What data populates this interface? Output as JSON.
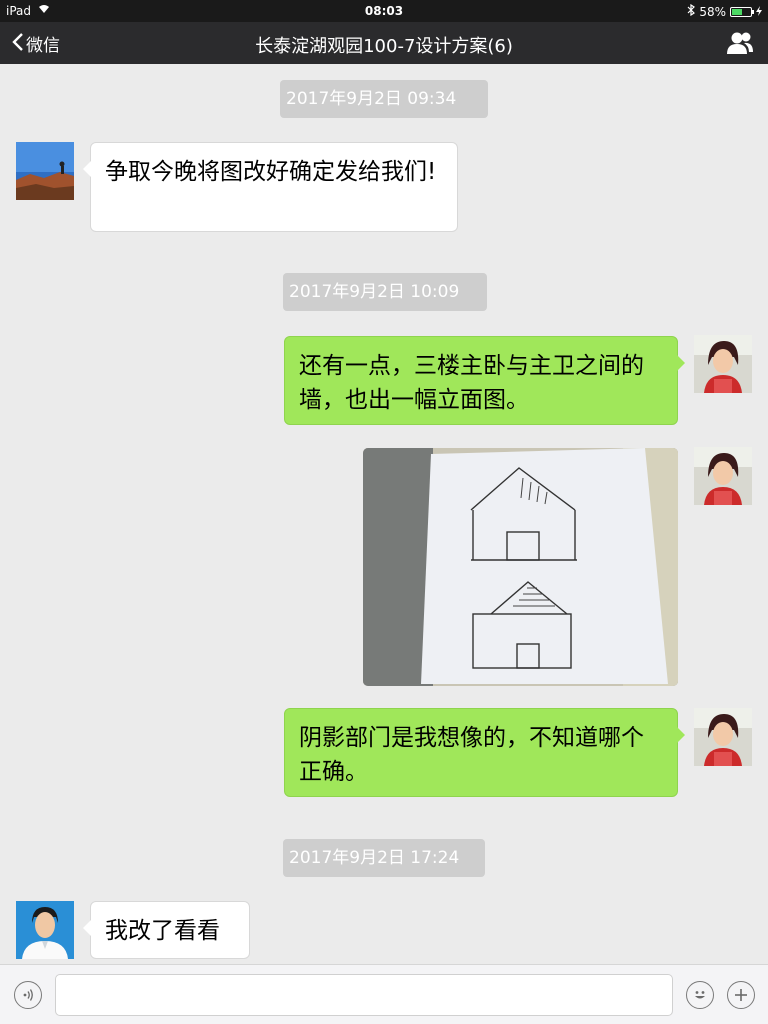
{
  "status_bar": {
    "device": "iPad",
    "time": "08:03",
    "battery": "58%",
    "battery_level": 0.58
  },
  "nav": {
    "back_label": "微信",
    "title": "长泰淀湖观园100-7设计方案(6)",
    "contacts_icon": "group-contacts-icon"
  },
  "messages": {
    "time1": "2017年9月2日 09:34",
    "msg1": "争取今晚将图改好确定发给我们!",
    "time2": "2017年9月2日 10:09",
    "msg2": "还有一点，三楼主卧与主卫之间的墙，也出一幅立面图。",
    "msg4": "阴影部门是我想像的，不知道哪个正确。",
    "time3": "2017年9月2日 17:24",
    "msg5": "我改了看看"
  },
  "input_bar": {
    "voice_icon": "voice-icon",
    "emoji_icon": "emoji-icon",
    "plus_icon": "plus-icon",
    "input_value": ""
  },
  "colors": {
    "nav_bg": "#2b2b2d",
    "chat_bg": "#ebebeb",
    "sent_bubble": "#a0e75a",
    "received_bubble": "#ffffff",
    "time_badge": "#cecece"
  }
}
